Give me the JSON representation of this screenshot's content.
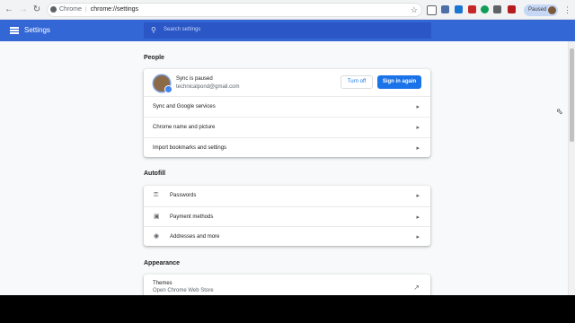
{
  "browser": {
    "omnibox_site": "Chrome",
    "omnibox_url": "chrome://settings",
    "profile_status": "Paused",
    "extension_colors": [
      "#f1f3f4",
      "#4d6fa8",
      "#2e7d32",
      "#1976d2",
      "#c62828",
      "#0f9d58",
      "#5f6368",
      "#d4b106",
      "#b71c1c"
    ]
  },
  "header": {
    "title": "Settings",
    "search_placeholder": "Search settings"
  },
  "sections": {
    "people": {
      "title": "People",
      "sync_title": "Sync is paused",
      "sync_email": "technicalpond@gmail.com",
      "turn_off": "Turn off",
      "sign_in_again": "Sign in again",
      "rows": [
        "Sync and Google services",
        "Chrome name and picture",
        "Import bookmarks and settings"
      ]
    },
    "autofill": {
      "title": "Autofill",
      "rows": [
        {
          "label": "Passwords",
          "icon": "key-icon"
        },
        {
          "label": "Payment methods",
          "icon": "credit-card-icon"
        },
        {
          "label": "Addresses and more",
          "icon": "location-pin-icon"
        }
      ]
    },
    "appearance": {
      "title": "Appearance",
      "themes_title": "Themes",
      "themes_subtitle": "Open Chrome Web Store"
    }
  }
}
